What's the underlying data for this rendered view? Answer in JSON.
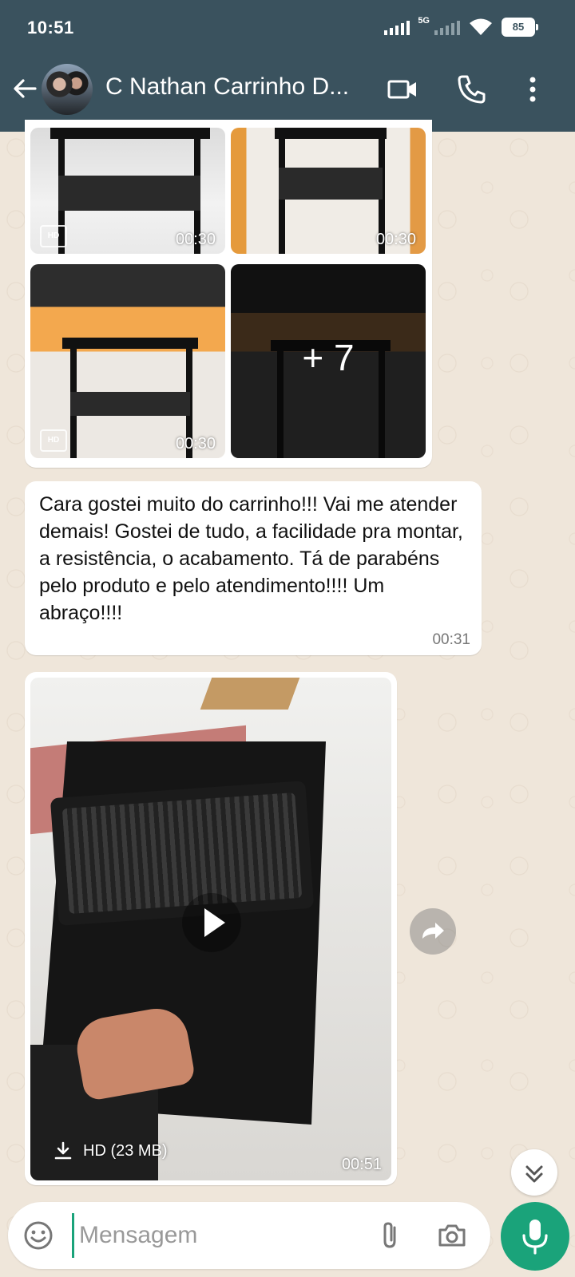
{
  "status_bar": {
    "time": "10:51",
    "network": "5G",
    "battery": "85"
  },
  "header": {
    "contact_name": "C Nathan Carrinho D..."
  },
  "media_grid": {
    "durations": [
      "00:30",
      "00:30",
      "00:30"
    ],
    "more_count": "+ 7",
    "hd_label": "HD"
  },
  "text_message": {
    "body": "Cara gostei muito do carrinho!!! Vai me atender demais! Gostei de tudo, a facilidade pra montar, a resistência, o acabamento. Tá de parabéns pelo produto e pelo atendimento!!!! Um abraço!!!!",
    "time": "00:31"
  },
  "video_message": {
    "download_label": "HD (23 MB)",
    "duration": "00:51"
  },
  "composer": {
    "placeholder": "Mensagem"
  },
  "colors": {
    "header_bg": "#3a525e",
    "accent": "#1aa37a",
    "bubble": "#ffffff",
    "wallpaper": "#efe6da"
  }
}
